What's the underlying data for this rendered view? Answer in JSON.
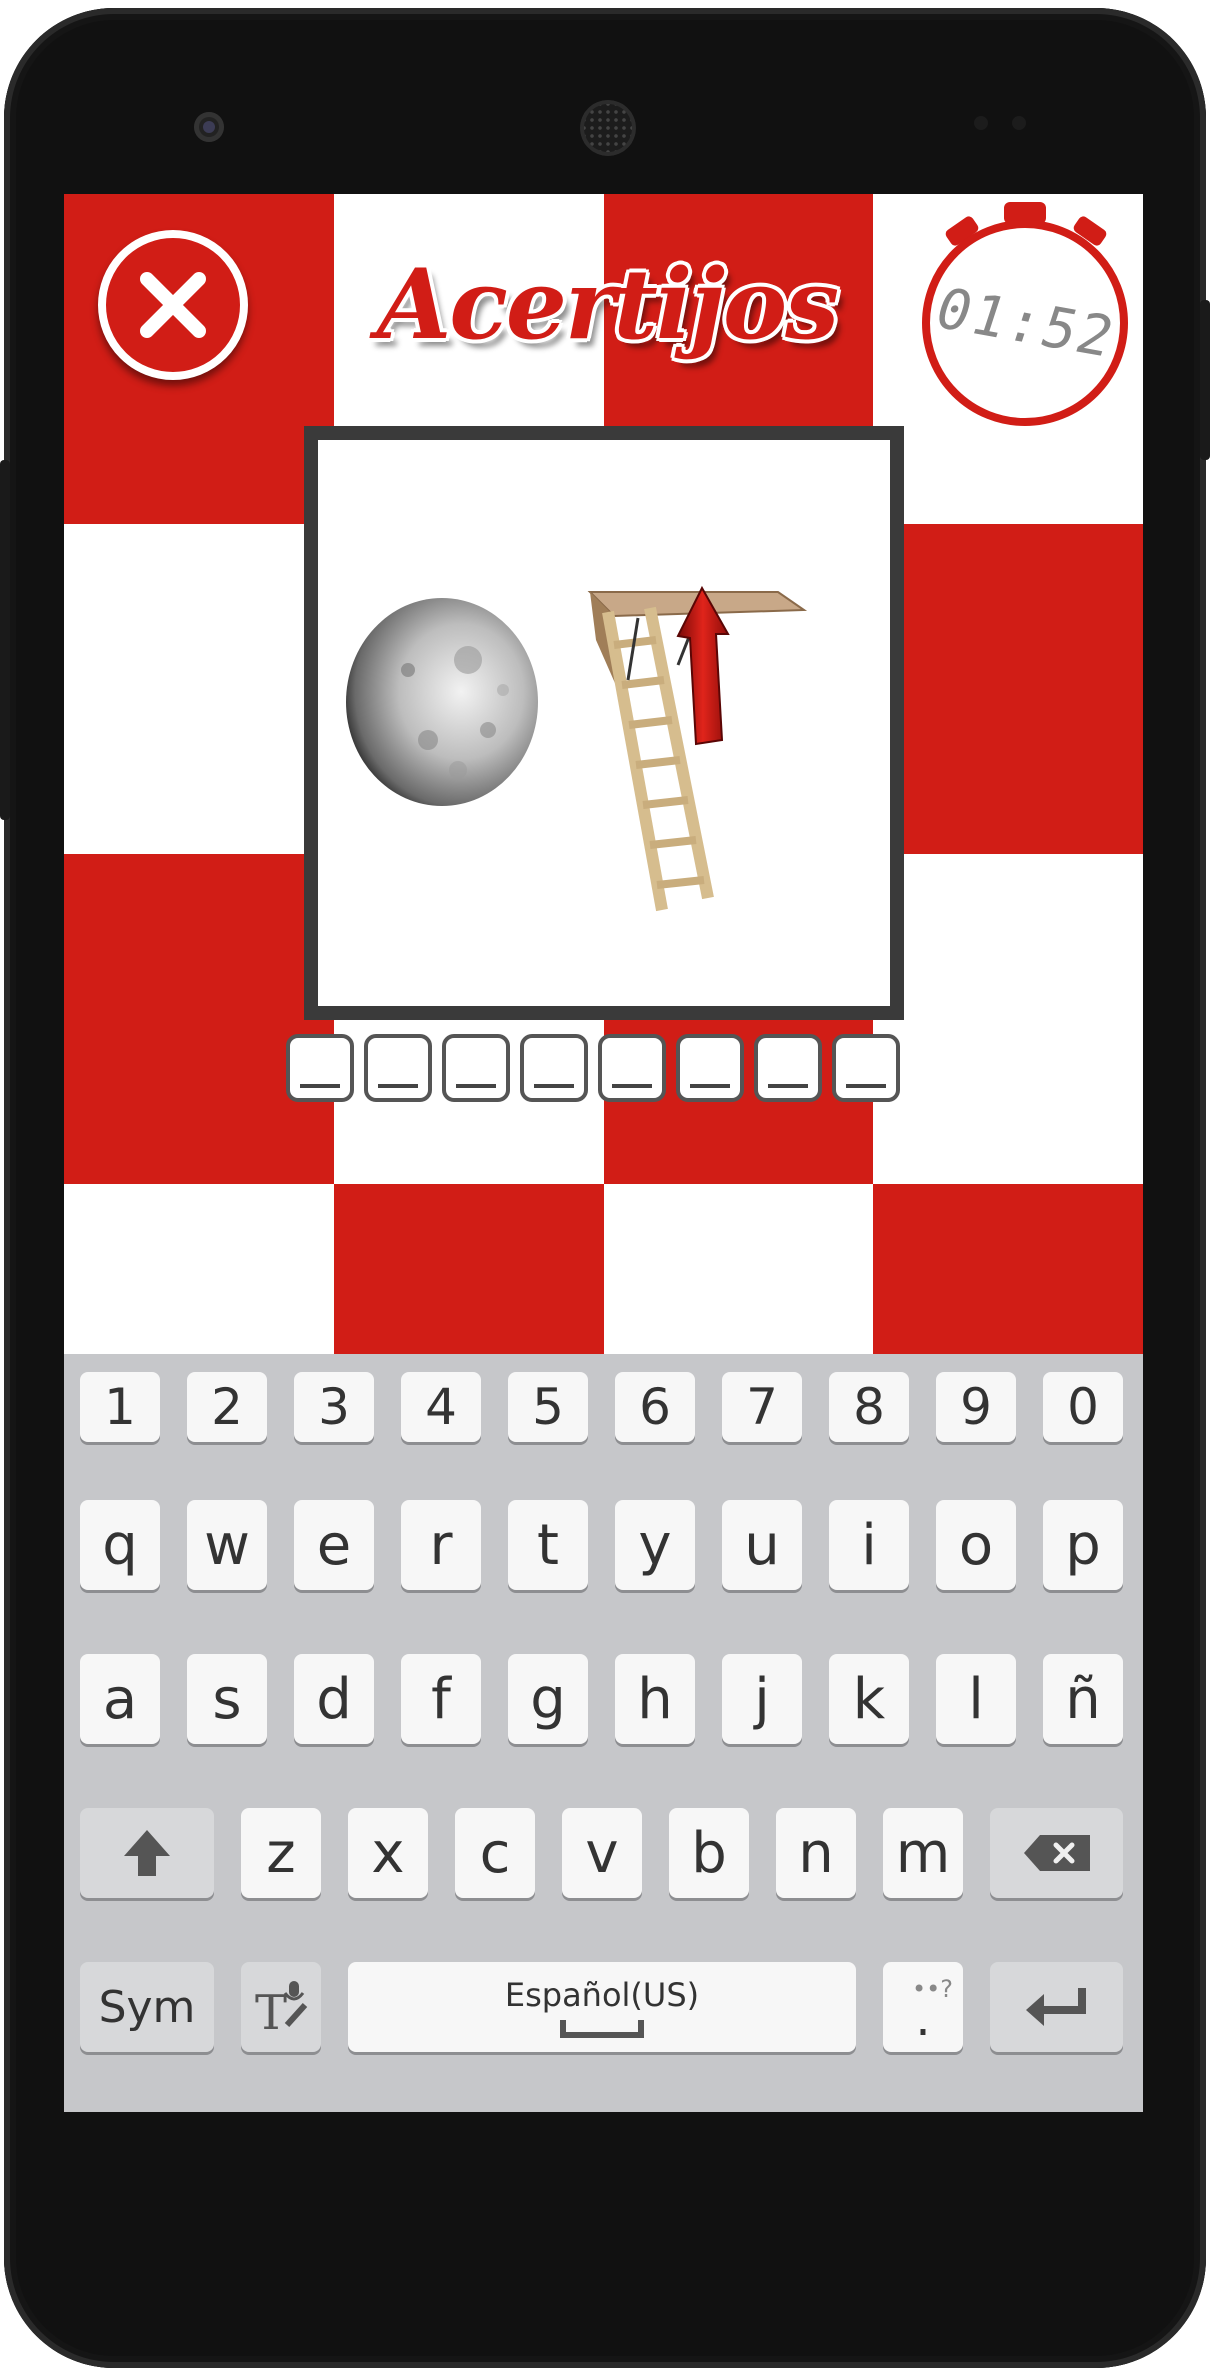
{
  "app": {
    "title": "Acertijos",
    "timer": "01:52",
    "answer_slots": [
      "_",
      "_",
      "_",
      "_",
      "_",
      "_",
      "_",
      "_"
    ],
    "colors": {
      "red": "#d11d16",
      "frame": "#3a3a3a",
      "keyboard_bg": "#c6c7ca"
    },
    "icons": {
      "close": "close-icon",
      "timer": "stopwatch-icon"
    }
  },
  "keyboard": {
    "numbers": [
      "1",
      "2",
      "3",
      "4",
      "5",
      "6",
      "7",
      "8",
      "9",
      "0"
    ],
    "row1": [
      "q",
      "w",
      "e",
      "r",
      "t",
      "y",
      "u",
      "i",
      "o",
      "p"
    ],
    "row2": [
      "a",
      "s",
      "d",
      "f",
      "g",
      "h",
      "j",
      "k",
      "l",
      "ñ"
    ],
    "row3": [
      "z",
      "x",
      "c",
      "v",
      "b",
      "n",
      "m"
    ],
    "sym_label": "Sym",
    "space_label": "Español(US)",
    "punct_label": "••?",
    "punct_dot": ".",
    "icons": {
      "shift": "shift-arrow-icon",
      "backspace": "backspace-icon",
      "voice_text": "voice-text-icon",
      "enter": "enter-icon"
    }
  }
}
